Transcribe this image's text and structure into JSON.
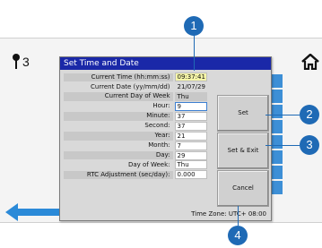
{
  "status": {
    "indicator_value": "3"
  },
  "icons": {
    "key": "key-icon",
    "home": "home-icon",
    "back": "back-arrow-icon"
  },
  "dialog": {
    "title": "Set Time and Date",
    "rows": [
      {
        "label": "Current Time (hh:mm:ss)",
        "value": "09:37:41"
      },
      {
        "label": "Current Date (yy/mm/dd)",
        "value": "21/07/29"
      },
      {
        "label": "Current Day of Week",
        "value": "Thu"
      },
      {
        "label": "Hour:",
        "value": "9"
      },
      {
        "label": "Minute:",
        "value": "37"
      },
      {
        "label": "Second:",
        "value": "37"
      },
      {
        "label": "Year:",
        "value": "21"
      },
      {
        "label": "Month:",
        "value": "7"
      },
      {
        "label": "Day:",
        "value": "29"
      },
      {
        "label": "Day of Week:",
        "value": "Thu"
      },
      {
        "label": "RTC Adjustment (sec/day):",
        "value": "0.000"
      }
    ],
    "timezone": "Time Zone: UTC+ 08:00",
    "buttons": {
      "set": "Set",
      "set_exit": "Set & Exit",
      "cancel": "Cancel"
    }
  },
  "callouts": [
    "1",
    "2",
    "3",
    "4"
  ],
  "colors": {
    "title_bar": "#1a28a8",
    "callout": "#1f6ab5",
    "tab": "#3d8fd6"
  }
}
